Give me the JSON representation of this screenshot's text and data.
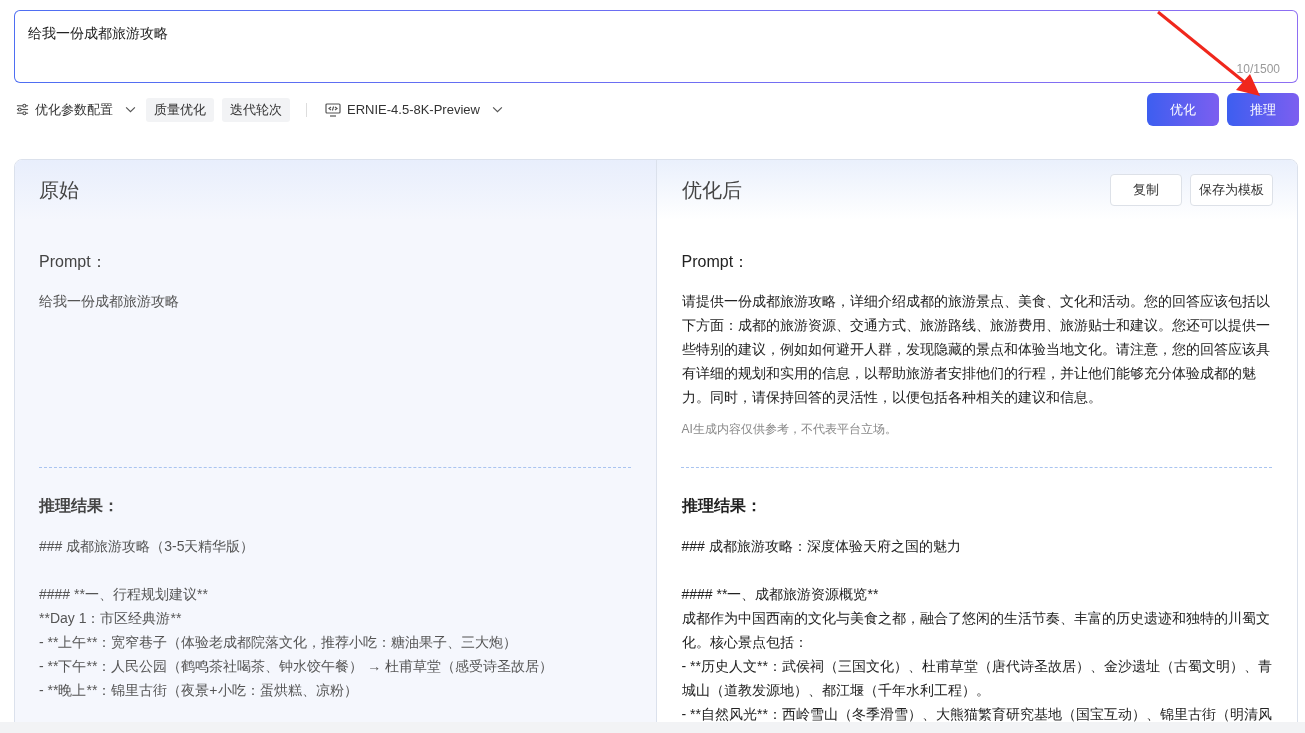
{
  "input": {
    "value": "给我一份成都旅游攻略",
    "counter": "10/1500"
  },
  "toolbar": {
    "settings": "优化参数配置",
    "tags": [
      "质量优化",
      "迭代轮次"
    ],
    "model": "ERNIE-4.5-8K-Preview"
  },
  "actions": [
    "优化",
    "推理"
  ],
  "panels": [
    {
      "kind": "original",
      "title": "原始",
      "prompt_label": "Prompt：",
      "prompt": [
        "给我一份成都旅游攻略"
      ],
      "result_label": "推理结果：",
      "result": [
        [
          "### 成都旅游攻略（3-5天精华版）"
        ],
        [
          "#### **一、行程规划建议**",
          "**Day 1：市区经典游**",
          "- **上午**：宽窄巷子（体验老成都院落文化，推荐小吃：糖油果子、三大炮）",
          "- **下午**：人民公园（鹤鸣茶社喝茶、钟水饺午餐） → 杜甫草堂（感受诗圣故居）",
          "- **晚上**：锦里古街（夜景+小吃：蛋烘糕、凉粉）"
        ]
      ]
    },
    {
      "kind": "optimized",
      "title": "优化后",
      "buttons": [
        "复制",
        "保存为模板"
      ],
      "prompt_label": "Prompt：",
      "prompt": [
        "请提供一份成都旅游攻略，详细介绍成都的旅游景点、美食、文化和活动。您的回答应该包括以下方面：成都的旅游资源、交通方式、旅游路线、旅游费用、旅游贴士和建议。您还可以提供一些特别的建议，例如如何避开人群，发现隐藏的景点和体验当地文化。请注意，您的回答应该具有详细的规划和实用的信息，以帮助旅游者安排他们的行程，并让他们能够充分体验成都的魅力。同时，请保持回答的灵活性，以便包括各种相关的建议和信息。"
      ],
      "disclaimer": "AI生成内容仅供参考，不代表平台立场。",
      "result_label": "推理结果：",
      "result": [
        [
          "### 成都旅游攻略：深度体验天府之国的魅力"
        ],
        [
          "#### **一、成都旅游资源概览**",
          "成都作为中国西南的文化与美食之都，融合了悠闲的生活节奏、丰富的历史遗迹和独特的川蜀文化。核心景点包括：",
          "- **历史人文**：武侯祠（三国文化）、杜甫草堂（唐代诗圣故居）、金沙遗址（古蜀文明）、青城山（道教发源地）、都江堰（千年水利工程）。",
          "- **自然风光**：西岭雪山（冬季滑雪）、大熊猫繁育研究基地（国宝互动）、锦里古街（明清风"
        ]
      ]
    }
  ]
}
